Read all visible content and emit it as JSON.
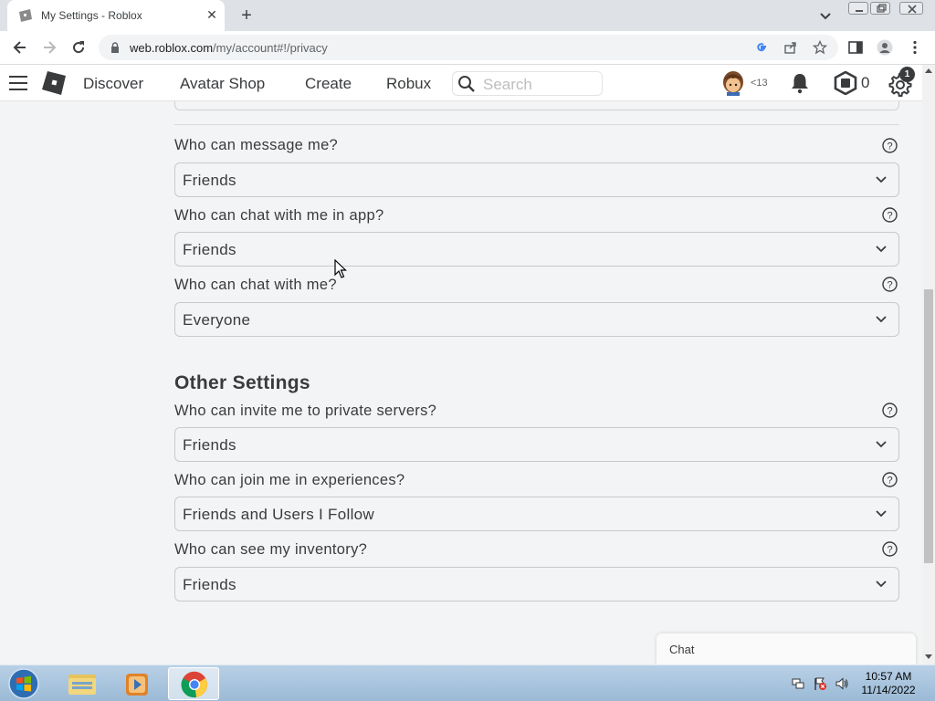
{
  "browser": {
    "tab_title": "My Settings - Roblox",
    "url_host": "web.roblox.com",
    "url_path": "/my/account#!/privacy"
  },
  "header": {
    "nav": [
      "Discover",
      "Avatar Shop",
      "Create",
      "Robux"
    ],
    "search_placeholder": "Search",
    "age_label": "<13",
    "robux_count": "0",
    "notification_count": "1"
  },
  "privacy": {
    "message": {
      "label": "Who can message me?",
      "value": "Friends"
    },
    "app_chat": {
      "label": "Who can chat with me in app?",
      "value": "Friends"
    },
    "chat": {
      "label": "Who can chat with me?",
      "value": "Everyone"
    }
  },
  "other_settings": {
    "title": "Other Settings",
    "private_servers": {
      "label": "Who can invite me to private servers?",
      "value": "Friends"
    },
    "join": {
      "label": "Who can join me in experiences?",
      "value": "Friends and Users I Follow"
    },
    "inventory": {
      "label": "Who can see my inventory?",
      "value": "Friends"
    }
  },
  "chat_widget": {
    "label": "Chat"
  },
  "taskbar": {
    "time": "10:57 AM",
    "date": "11/14/2022"
  },
  "colors": {
    "text": "#393b3d",
    "page_bg": "#f2f4f5",
    "taskbar": "#9bbad6"
  }
}
